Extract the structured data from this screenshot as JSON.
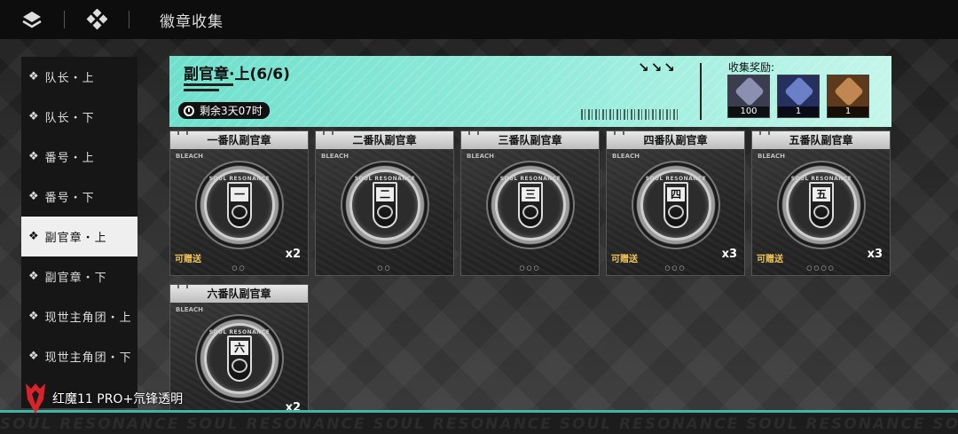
{
  "header": {
    "title": "徽章收集",
    "menu_icon": "layers-icon",
    "home_icon": "diamond-grid-icon"
  },
  "sidebar": {
    "items": [
      {
        "label": "队长・上",
        "active": false
      },
      {
        "label": "队长・下",
        "active": false
      },
      {
        "label": "番号・上",
        "active": false
      },
      {
        "label": "番号・下",
        "active": false
      },
      {
        "label": "副官章・上",
        "active": true
      },
      {
        "label": "副官章・下",
        "active": false
      },
      {
        "label": "现世主角团・上",
        "active": false
      },
      {
        "label": "现世主角团・下",
        "active": false
      }
    ]
  },
  "banner": {
    "title": "副官章·上(6/6)",
    "timer": "剩余3天07时",
    "arrows": "↘↘↘",
    "reward_label": "收集奖励:",
    "rewards": [
      {
        "qty": "100",
        "color": "#6b6f8a"
      },
      {
        "qty": "1",
        "color": "#3b4a86"
      },
      {
        "qty": "1",
        "color": "#8a5a2b"
      }
    ]
  },
  "badges": [
    {
      "name": "一番队副官章",
      "numeral": "一",
      "giftable": "可赠送",
      "qty": "x2",
      "dots": "○○"
    },
    {
      "name": "二番队副官章",
      "numeral": "二",
      "giftable": "",
      "qty": "",
      "dots": "○○"
    },
    {
      "name": "三番队副官章",
      "numeral": "三",
      "giftable": "",
      "qty": "",
      "dots": "○○○"
    },
    {
      "name": "四番队副官章",
      "numeral": "四",
      "giftable": "可赠送",
      "qty": "x3",
      "dots": "○○○"
    },
    {
      "name": "五番队副官章",
      "numeral": "五",
      "giftable": "可赠送",
      "qty": "x3",
      "dots": "○○○○"
    },
    {
      "name": "六番队副官章",
      "numeral": "六",
      "giftable": "",
      "qty": "x2",
      "dots": ""
    }
  ],
  "card_brand": "BLEACH",
  "ring_text": "SOUL RESONANCE",
  "bottom_text": "SOUL RESONANCE    SOUL RESONANCE    SOUL RESONANCE    SOUL RESONANCE    SOUL RESONANCE    SOUL RESONANCE",
  "watermark": "红魔11 PRO+氘锋透明",
  "colors": {
    "accent": "#6fe0cc",
    "gift": "#f0c458"
  }
}
